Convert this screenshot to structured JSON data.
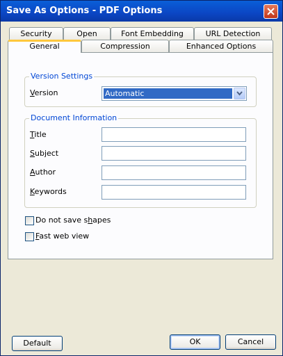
{
  "window": {
    "title": "Save As Options - PDF Options"
  },
  "tabs": {
    "row_back": [
      "Security",
      "Open",
      "Font Embedding",
      "URL Detection"
    ],
    "row_front": [
      "General",
      "Compression",
      "Enhanced Options"
    ],
    "active": "General"
  },
  "version_settings": {
    "title": "Version Settings",
    "version_label": "Version",
    "version_value": "Automatic"
  },
  "document_information": {
    "title": "Document Information",
    "fields": [
      {
        "label": "Title",
        "value": ""
      },
      {
        "label": "Subject",
        "value": ""
      },
      {
        "label": "Author",
        "value": ""
      },
      {
        "label": "Keywords",
        "value": ""
      }
    ]
  },
  "options": {
    "do_not_save_shapes": {
      "label": "Do not save shapes",
      "checked": false
    },
    "fast_web_view": {
      "label": "Fast web view",
      "checked": false
    }
  },
  "buttons": {
    "default": "Default",
    "ok": "OK",
    "cancel": "Cancel"
  },
  "colors": {
    "title_bar": "#0b46c4",
    "active_tab_highlight": "#ffc83c",
    "group_title": "#0046d5",
    "selection": "#316ac5"
  }
}
